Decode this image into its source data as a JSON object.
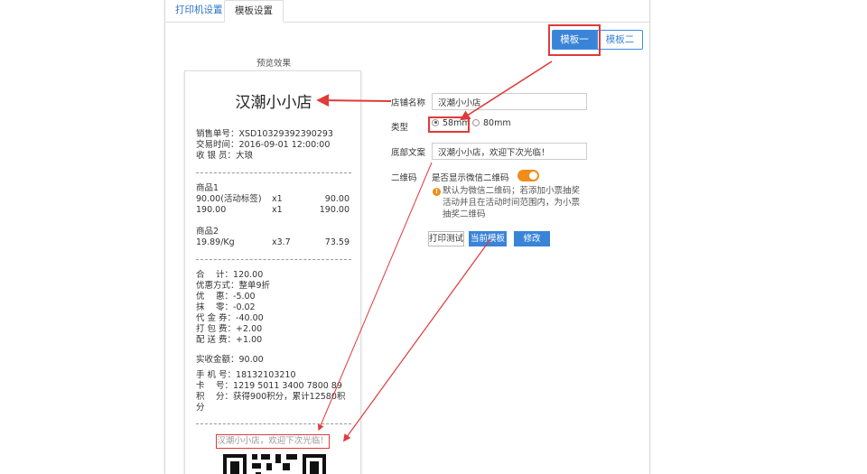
{
  "tabs": [
    {
      "label": "打印机设置"
    },
    {
      "label": "模板设置"
    }
  ],
  "template_buttons": {
    "one": "模板一",
    "two": "模板二"
  },
  "preview": {
    "label": "预览效果",
    "store_name": "汉潮小小店",
    "order_no": "销售单号：XSD10329392390293",
    "trade_time": "交易时间：2016-09-01 12:00:00",
    "cashier": "收 银 员：大琅",
    "items": [
      {
        "name": "商品1",
        "rows": [
          [
            "90.00(活动标签)",
            "x1",
            "90.00"
          ],
          [
            "190.00",
            "x1",
            "190.00"
          ]
        ]
      },
      {
        "name": "商品2",
        "rows": [
          [
            "19.89/Kg",
            "x3.7",
            "73.59"
          ]
        ]
      }
    ],
    "summary": [
      "合　 计：120.00",
      "优惠方式：整单9折",
      "优　 惠：-5.00",
      "抹　 零：-0.02",
      "代 金 券：-40.00",
      "打 包 费：+2.00",
      "配 送 费：+1.00"
    ],
    "paid": "实收金额：90.00",
    "phone": "手 机 号：18132103210",
    "card": "卡　  号：1219 5011 3400 7800 89",
    "points_line1": "积　  分：获得900积分，累计12580积",
    "points_line2": "分",
    "footer": "汉潮小小店，欢迎下次光临！"
  },
  "form": {
    "store_label": "店铺名称",
    "store_value": "汉潮小小店",
    "type_label": "类型",
    "type_options": [
      "58mm",
      "80mm"
    ],
    "type_selected": "58mm",
    "footer_label": "底部文案",
    "footer_value": "汉潮小小店，欢迎下次光临！",
    "qr_label": "二维码",
    "qr_toggle_text": "是否显示微信二维码",
    "qr_enabled": true,
    "qr_note": "默认为微信二维码；若添加小票抽奖活动并且在活动时间范围内，为小票抽奖二维码",
    "btn_print_test": "打印测试",
    "btn_current": "当前模板",
    "btn_edit": "修改"
  },
  "colors": {
    "accent": "#3a84d8",
    "highlight": "#e03a3a",
    "toggle": "#ef8c1a"
  }
}
